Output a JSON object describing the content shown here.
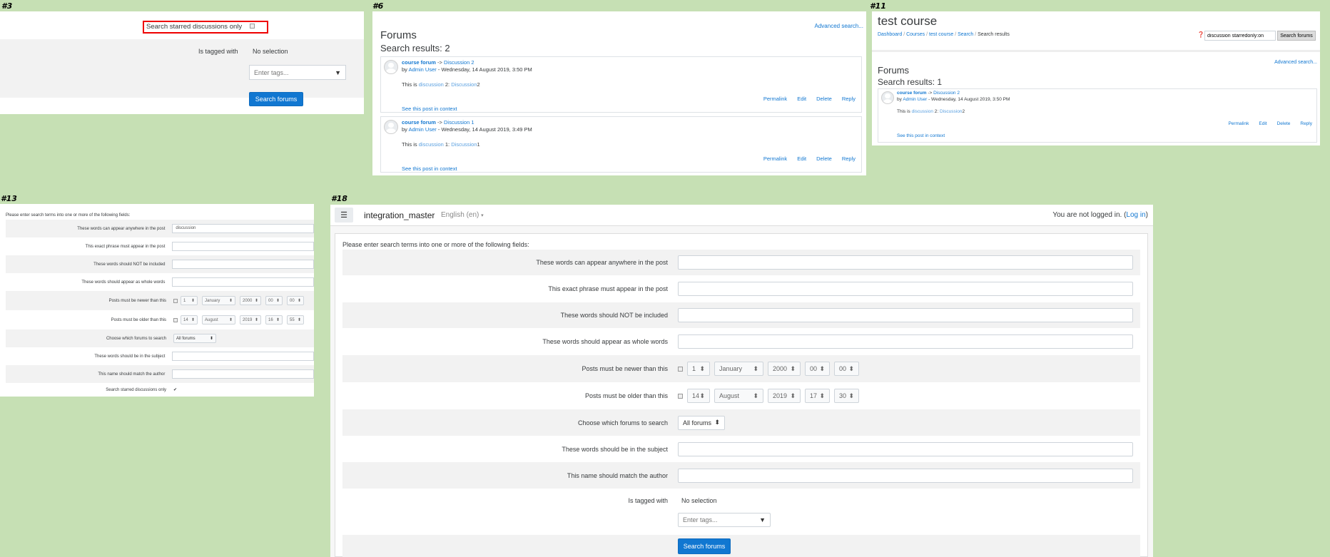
{
  "labels": {
    "p3": "#3",
    "p6": "#6",
    "p11": "#11",
    "p13": "#13",
    "p18": "#18"
  },
  "panel3": {
    "starred_label": "Search starred discussions only",
    "tagged_label": "Is tagged with",
    "no_selection": "No selection",
    "tags_placeholder": "Enter tags...",
    "search_button": "Search forums"
  },
  "panel6": {
    "advanced": "Advanced search...",
    "heading": "Forums",
    "results": "Search results: 2",
    "posts": [
      {
        "forum": "course forum",
        "arrow": " -> ",
        "discussion": "Discussion 2",
        "by": "by ",
        "author": "Admin User",
        "date": " - Wednesday, 14 August 2019, 3:50 PM",
        "body_pre": "This is ",
        "hl1": "discussion",
        "body_mid": " 2: ",
        "hl2": "Discussion",
        "body_post": "2",
        "cmds": [
          "Permalink",
          "Edit",
          "Delete",
          "Reply"
        ],
        "context": "See this post in context"
      },
      {
        "forum": "course forum",
        "arrow": " -> ",
        "discussion": "Discussion 1",
        "by": "by ",
        "author": "Admin User",
        "date": " - Wednesday, 14 August 2019, 3:49 PM",
        "body_pre": "This is ",
        "hl1": "discussion",
        "body_mid": " 1: ",
        "hl2": "Discussion",
        "body_post": "1",
        "cmds": [
          "Permalink",
          "Edit",
          "Delete",
          "Reply"
        ],
        "context": "See this post in context"
      }
    ]
  },
  "panel11": {
    "course_title": "test course",
    "breadcrumb": [
      "Dashboard",
      "Courses",
      "test course",
      "Search",
      "Search results"
    ],
    "search_value": "discussion starredonly:on",
    "search_button": "Search forums",
    "advanced": "Advanced search...",
    "heading": "Forums",
    "results": "Search results: 1",
    "post": {
      "forum": "course forum",
      "arrow": " -> ",
      "discussion": "Discussion 2",
      "by": "by ",
      "author": "Admin User",
      "date": " - Wednesday, 14 August 2019, 3:50 PM",
      "body_pre": "This is ",
      "hl1": "discussion",
      "body_mid": " 2: ",
      "hl2": "Discussion",
      "body_post": "2",
      "cmds": [
        "Permalink",
        "Edit",
        "Delete",
        "Reply"
      ],
      "context": "See this post in context"
    }
  },
  "panel13": {
    "intro": "Please enter search terms into one or more of the following fields:",
    "words_anywhere": "These words can appear anywhere in the post",
    "words_anywhere_value": "discussion",
    "exact_phrase": "This exact phrase must appear in the post",
    "not_included": "These words should NOT be included",
    "whole_words": "These words should appear as whole words",
    "newer": "Posts must be newer than this",
    "newer_vals": [
      "1",
      "January",
      "2000",
      "00",
      "00"
    ],
    "older": "Posts must be older than this",
    "older_vals": [
      "14",
      "August",
      "2019",
      "16",
      "55"
    ],
    "choose_forums": "Choose which forums to search",
    "forums_value": "All forums",
    "subject": "These words should be in the subject",
    "author": "This name should match the author",
    "starred": "Search starred discussions only",
    "starred_mark": "✔"
  },
  "panel18": {
    "site_name": "integration_master",
    "language": "English (en)",
    "login_text": "You are not logged in. (",
    "login_link": "Log in",
    "login_close": ")",
    "intro": "Please enter search terms into one or more of the following fields:",
    "words_anywhere": "These words can appear anywhere in the post",
    "exact_phrase": "This exact phrase must appear in the post",
    "not_included": "These words should NOT be included",
    "whole_words": "These words should appear as whole words",
    "newer": "Posts must be newer than this",
    "newer_vals": [
      "1",
      "January",
      "2000",
      "00",
      "00"
    ],
    "older": "Posts must be older than this",
    "older_vals": [
      "14",
      "August",
      "2019",
      "17",
      "30"
    ],
    "choose_forums": "Choose which forums to search",
    "forums_value": "All forums",
    "subject": "These words should be in the subject",
    "author": "This name should match the author",
    "tagged": "Is tagged with",
    "no_selection": "No selection",
    "tags_placeholder": "Enter tags...",
    "search_button": "Search forums"
  }
}
